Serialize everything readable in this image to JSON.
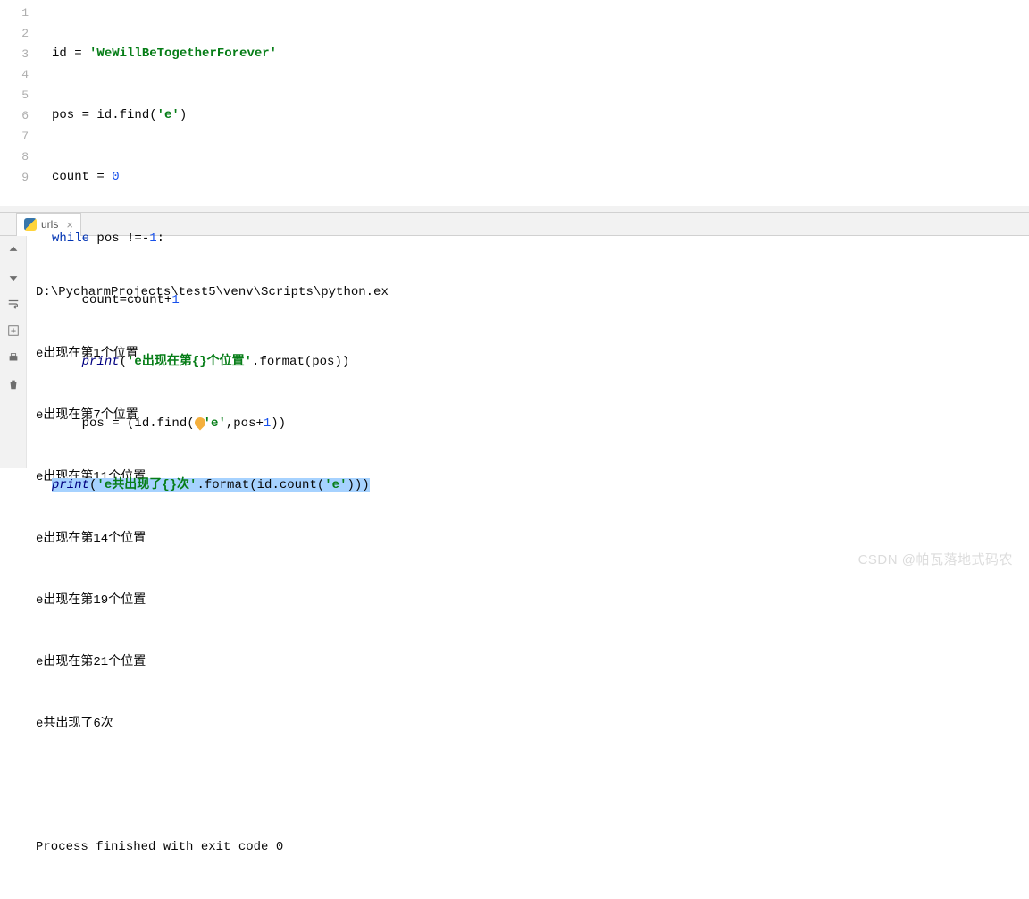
{
  "editor": {
    "lines": [
      "1",
      "2",
      "3",
      "4",
      "5",
      "6",
      "7",
      "8",
      "9"
    ],
    "code": {
      "l1": {
        "a": "id = ",
        "b": "'WeWillBeTogetherForever'"
      },
      "l2": {
        "a": "pos = id.find(",
        "b": "'e'",
        "c": ")"
      },
      "l3": {
        "a": "count = ",
        "b": "0"
      },
      "l4": {
        "a": "while",
        "b": " pos !=-",
        "c": "1",
        "d": ":"
      },
      "l5": {
        "a": "    count=count+",
        "b": "1"
      },
      "l6": {
        "a": "    ",
        "b": "print",
        "c": "(",
        "d": "'e出现在第{}个位置'",
        "e": ".format(pos))"
      },
      "l7": {
        "a": "    pos = (id.find(",
        "b": "'e'",
        "c": ",pos+",
        "d": "1",
        "e": "))"
      },
      "l8": {
        "a": "print",
        "b": "(",
        "c": "'e共出现了{}次'",
        "d": ".format(id.count(",
        "e": "'e'",
        "f": ")))"
      }
    }
  },
  "tab": {
    "label": "urls"
  },
  "console": {
    "path": "D:\\PycharmProjects\\test5\\venv\\Scripts\\python.ex",
    "out": [
      "e出现在第1个位置",
      "e出现在第7个位置",
      "e出现在第11个位置",
      "e出现在第14个位置",
      "e出现在第19个位置",
      "e出现在第21个位置",
      "e共出现了6次"
    ],
    "exit": "Process finished with exit code 0"
  },
  "watermark": "CSDN @帕瓦落地式码农"
}
